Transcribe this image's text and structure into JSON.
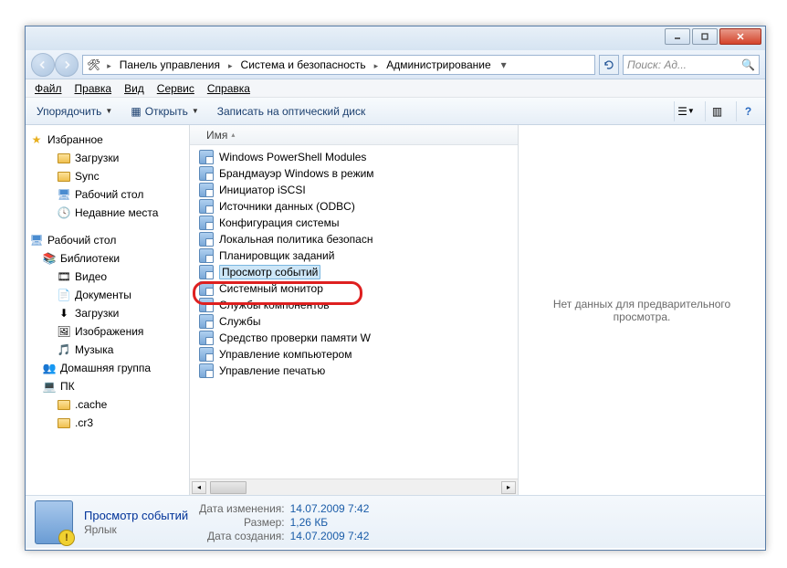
{
  "window_controls": {
    "minimize": "min",
    "maximize": "max",
    "close": "close"
  },
  "address": {
    "crumbs": [
      "Панель управления",
      "Система и безопасность",
      "Администрирование"
    ],
    "search_placeholder": "Поиск: Ад..."
  },
  "menu": {
    "file": "Файл",
    "edit": "Правка",
    "view": "Вид",
    "tools": "Сервис",
    "help": "Справка"
  },
  "toolbar": {
    "organize": "Упорядочить",
    "open": "Открыть",
    "burn": "Записать на оптический диск"
  },
  "nav": {
    "favorites": "Избранное",
    "fav_items": [
      "Загрузки",
      "Sync",
      "Рабочий стол",
      "Недавние места"
    ],
    "desktop": "Рабочий стол",
    "libraries": "Библиотеки",
    "lib_items": [
      "Видео",
      "Документы",
      "Загрузки",
      "Изображения",
      "Музыка"
    ],
    "homegroup": "Домашняя группа",
    "pc": "ПК",
    "pc_items": [
      ".cache",
      ".cr3"
    ]
  },
  "list": {
    "col_name": "Имя",
    "items": [
      "Windows PowerShell Modules",
      "Брандмауэр Windows в режим",
      "Инициатор iSCSI",
      "Источники данных (ODBC)",
      "Конфигурация системы",
      "Локальная политика безопасн",
      "Планировщик заданий",
      "Просмотр событий",
      "Системный монитор",
      "Службы компонентов",
      "Службы",
      "Средство проверки памяти W",
      "Управление компьютером",
      "Управление печатью"
    ],
    "selected_index": 7
  },
  "preview": {
    "empty": "Нет данных для предварительного просмотра."
  },
  "details": {
    "name": "Просмотр событий",
    "type": "Ярлык",
    "modified_label": "Дата изменения:",
    "modified": "14.07.2009 7:42",
    "size_label": "Размер:",
    "size": "1,26 КБ",
    "created_label": "Дата создания:",
    "created": "14.07.2009 7:42"
  }
}
